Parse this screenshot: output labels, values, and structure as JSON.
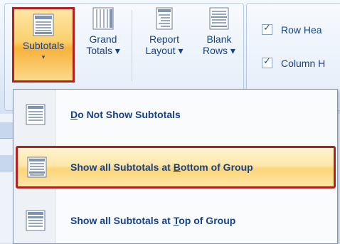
{
  "ribbon": {
    "buttons": [
      {
        "line1": "Subtotals",
        "line2": "▾",
        "icon": "subtotals-icon"
      },
      {
        "line1": "Grand",
        "line2": "Totals ▾",
        "icon": "grand-totals-icon"
      },
      {
        "line1": "Report",
        "line2": "Layout ▾",
        "icon": "report-layout-icon"
      },
      {
        "line1": "Blank",
        "line2": "Rows ▾",
        "icon": "blank-rows-icon"
      }
    ],
    "options": [
      {
        "label": "Row Hea",
        "checked": true
      },
      {
        "label": "Column H",
        "checked": true
      }
    ]
  },
  "menu": {
    "items": [
      {
        "pre": "",
        "u": "D",
        "post": "o Not Show Subtotals",
        "selected": false
      },
      {
        "pre": "Show all Subtotals at ",
        "u": "B",
        "post": "ottom of Group",
        "selected": true
      },
      {
        "pre": "Show all Subtotals at ",
        "u": "T",
        "post": "op of Group",
        "selected": false
      }
    ]
  },
  "colors": {
    "highlight_border": "#b2201f",
    "ribbon_text": "#15428b",
    "hover_fill": "#fcd57a"
  }
}
